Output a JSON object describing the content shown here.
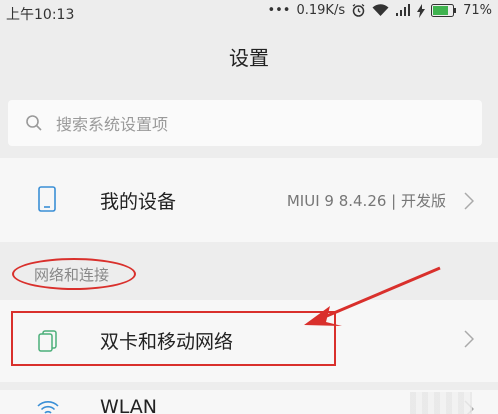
{
  "status_bar": {
    "time": "上午10:13",
    "dots": "•••",
    "speed": "0.19K/s",
    "battery": "71%"
  },
  "header": {
    "title": "设置"
  },
  "search": {
    "placeholder": "搜索系统设置项"
  },
  "my_device": {
    "label": "我的设备",
    "value": "MIUI 9 8.4.26 | 开发版"
  },
  "section": {
    "network_header": "网络和连接"
  },
  "items": [
    {
      "label": "双卡和移动网络",
      "icon": "sim-card-icon"
    },
    {
      "label": "WLAN",
      "icon": "wifi-icon"
    }
  ],
  "colors": {
    "annotation": "#d9302c",
    "accent": "#3a8fd6",
    "sim_icon": "#4caf7a"
  }
}
